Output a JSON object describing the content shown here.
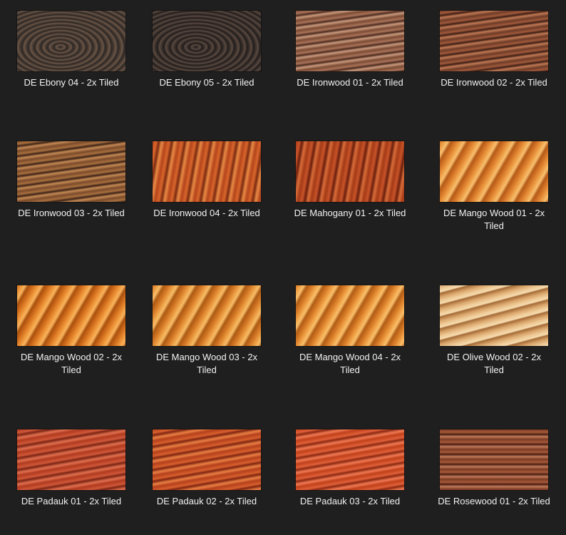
{
  "items": [
    {
      "label": "DE Ebony 04 - 2x Tiled",
      "texture": "ebony",
      "colors": [
        "#2b2624",
        "#4a3c33",
        "#6a5546",
        "#1e1a19"
      ]
    },
    {
      "label": "DE Ebony 05 - 2x Tiled",
      "texture": "ebony",
      "colors": [
        "#211d1c",
        "#3b302b",
        "#5a4a40",
        "#161312"
      ]
    },
    {
      "label": "DE Ironwood 01 - 2x Tiled",
      "texture": "ironwood",
      "colors": [
        "#7a4a32",
        "#a9735a",
        "#4c2a1d",
        "#c99a7e"
      ]
    },
    {
      "label": "DE Ironwood 02 - 2x Tiled",
      "texture": "ironwood",
      "colors": [
        "#6d3a26",
        "#a05a3c",
        "#3e1e14",
        "#c07a55"
      ]
    },
    {
      "label": "DE Ironwood 03 - 2x Tiled",
      "texture": "ironwood",
      "colors": [
        "#7b4a2a",
        "#a8703f",
        "#3d2216",
        "#c48a55"
      ]
    },
    {
      "label": "DE Ironwood 04 - 2x Tiled",
      "texture": "wavy",
      "colors": [
        "#b4451c",
        "#d9662c",
        "#7a2a10",
        "#e98a45"
      ]
    },
    {
      "label": "DE Mahogany 01 - 2x Tiled",
      "texture": "wavy",
      "colors": [
        "#a43a16",
        "#c8542a",
        "#6a1e0c",
        "#d86d3a"
      ]
    },
    {
      "label": "DE Mango Wood 01 - 2x Tiled",
      "texture": "mango",
      "colors": [
        "#d97a2a",
        "#f0a24a",
        "#b45a18",
        "#f7c070"
      ]
    },
    {
      "label": "DE Mango Wood 02 - 2x Tiled",
      "texture": "mango",
      "colors": [
        "#d4701e",
        "#f0983c",
        "#a9500e",
        "#f8b45e"
      ]
    },
    {
      "label": "DE Mango Wood 03 - 2x Tiled",
      "texture": "mango",
      "colors": [
        "#d27624",
        "#eea046",
        "#ac5a14",
        "#f6bd68"
      ]
    },
    {
      "label": "DE Mango Wood 04 - 2x Tiled",
      "texture": "mango",
      "colors": [
        "#d67a26",
        "#f2a44a",
        "#b05c16",
        "#f8c06c"
      ]
    },
    {
      "label": "DE Olive Wood 02 - 2x Tiled",
      "texture": "olive",
      "colors": [
        "#d8a46a",
        "#eec894",
        "#a46a36",
        "#f6dcb0"
      ]
    },
    {
      "label": "DE Padauk 01 - 2x Tiled",
      "texture": "padauk",
      "colors": [
        "#b03a1e",
        "#d0583a",
        "#7a2412",
        "#e07050"
      ]
    },
    {
      "label": "DE Padauk 02 - 2x Tiled",
      "texture": "padauk",
      "colors": [
        "#b4401c",
        "#d8602e",
        "#7e2410",
        "#ea8044"
      ]
    },
    {
      "label": "DE Padauk 03 - 2x Tiled",
      "texture": "padauk",
      "colors": [
        "#c0401a",
        "#e0603a",
        "#8a2810",
        "#f07a54"
      ]
    },
    {
      "label": "DE Rosewood 01 - 2x Tiled",
      "texture": "rosewood",
      "colors": [
        "#7a3a22",
        "#a85a3a",
        "#4a1e12",
        "#c07a5a"
      ]
    }
  ]
}
